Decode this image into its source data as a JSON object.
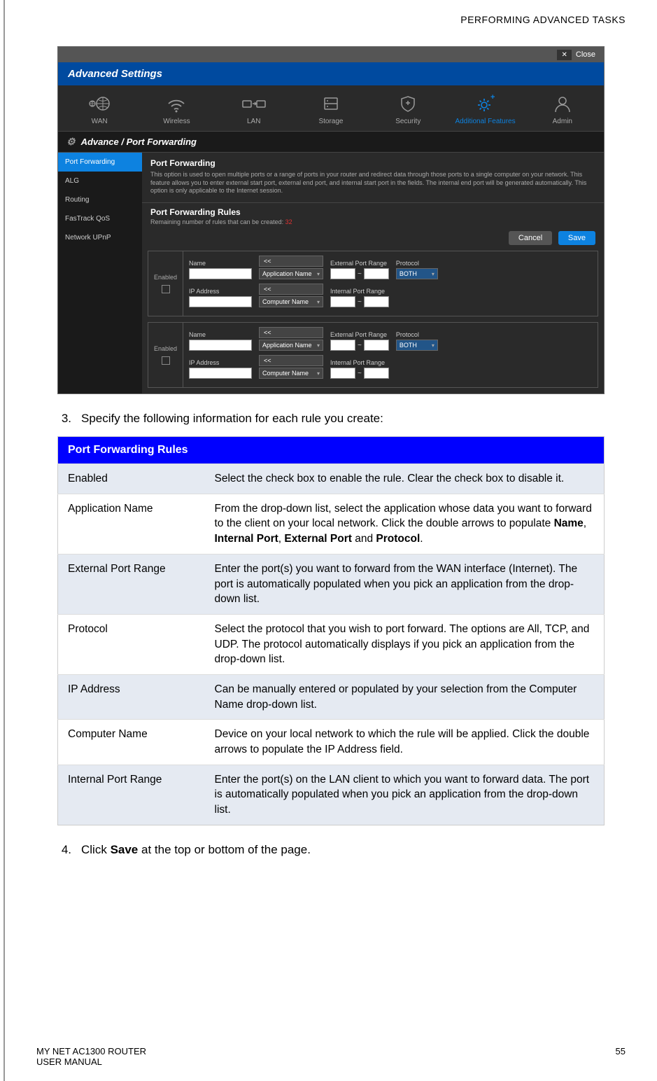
{
  "header": {
    "breadcrumb": "PERFORMING ADVANCED TASKS"
  },
  "screenshot": {
    "close_label": "Close",
    "close_x": "✕",
    "title": "Advanced Settings",
    "nav": [
      {
        "label": "WAN"
      },
      {
        "label": "Wireless"
      },
      {
        "label": "LAN"
      },
      {
        "label": "Storage"
      },
      {
        "label": "Security"
      },
      {
        "label": "Additional Features"
      },
      {
        "label": "Admin"
      }
    ],
    "section": "Advance / Port Forwarding",
    "sidebar": [
      {
        "label": "Port Forwarding"
      },
      {
        "label": "ALG"
      },
      {
        "label": "Routing"
      },
      {
        "label": "FasTrack QoS"
      },
      {
        "label": "Network UPnP"
      }
    ],
    "panel": {
      "heading": "Port Forwarding",
      "desc": "This option is used to open multiple ports or a range of ports in your router and redirect data through those ports to a single computer on your network. This feature allows you to enter external start port, external end port, and internal start port in the fields. The internal end port will be generated automatically. This option is only applicable to the Internet session.",
      "rules_heading": "Port Forwarding Rules",
      "rules_sub_pre": "Remaining number of rules that can be created: ",
      "rules_sub_num": "32",
      "cancel": "Cancel",
      "save": "Save"
    },
    "fields": {
      "enabled": "Enabled",
      "name": "Name",
      "app_name": "Application Name",
      "ip": "IP Address",
      "comp_name": "Computer Name",
      "ext_range": "External Port Range",
      "int_range": "Internal Port Range",
      "protocol": "Protocol",
      "both": "BOTH",
      "arrows": "<<"
    }
  },
  "steps": {
    "s3": "Specify the following information for each rule you create:",
    "s4_pre": "Click ",
    "s4_bold": "Save",
    "s4_post": " at the top or bottom of the page."
  },
  "table": {
    "header": "Port Forwarding Rules",
    "rows": [
      {
        "label": "Enabled",
        "desc": "Select the check box to enable the rule. Clear the check box to disable it."
      },
      {
        "label": "Application Name",
        "desc_pre": "From the drop-down list, select the application whose data you want to forward to the client on your local network. Click the double arrows to populate ",
        "b1": "Name",
        "c1": ", ",
        "b2": "Internal Port",
        "c2": ", ",
        "b3": "External Port",
        "c3": " and ",
        "b4": "Protocol",
        "c4": "."
      },
      {
        "label": "External Port Range",
        "desc": "Enter the port(s) you want to forward from the WAN interface (Internet). The port is automatically populated when you pick an application from the drop-down list."
      },
      {
        "label": "Protocol",
        "desc": "Select the protocol that you wish to port forward. The options are All, TCP, and UDP. The protocol automatically displays if you pick an application from the drop-down list."
      },
      {
        "label": "IP Address",
        "desc": "Can be manually entered or populated by your selection from the Computer Name drop-down list."
      },
      {
        "label": "Computer Name",
        "desc": "Device on your local network to which the rule will be applied. Click the double arrows to populate the IP Address field."
      },
      {
        "label": "Internal Port Range",
        "desc": "Enter the port(s) on the LAN client to which you want to forward data. The port is automatically populated when you pick an application from the drop-down list."
      }
    ]
  },
  "footer": {
    "left1": "MY NET AC1300 ROUTER",
    "left2": "USER MANUAL",
    "page": "55"
  }
}
